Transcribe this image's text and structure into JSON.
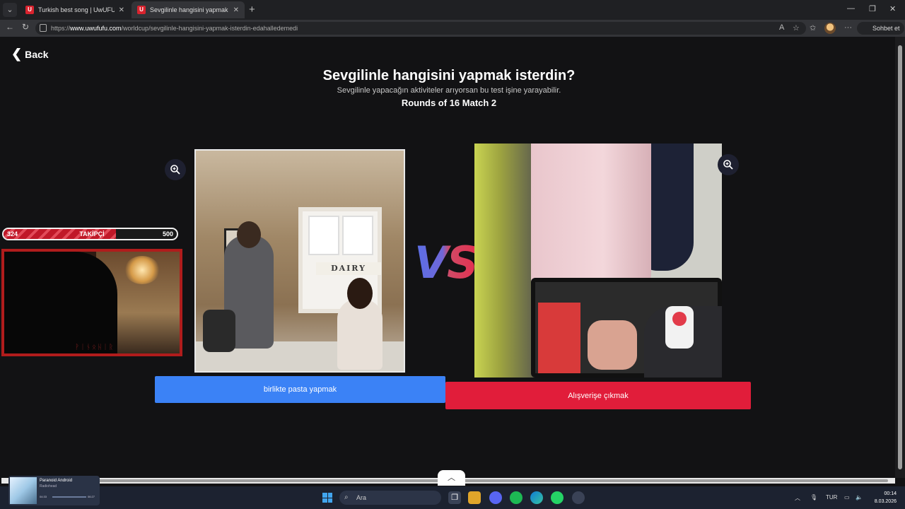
{
  "browser": {
    "tabs": [
      {
        "title": "Turkish best song | UwUFUFU",
        "favicon": "U",
        "active": false
      },
      {
        "title": "Sevgilinle hangisini yapmak isterdin",
        "favicon": "U",
        "active": true
      }
    ],
    "url_prefix": "https://",
    "url_host": "www.uwufufu.com",
    "url_path": "/worldcup/sevgilinle-hangisini-yapmak-isterdin-edahalledemedi",
    "copilot_label": "Sohbet et"
  },
  "page": {
    "back_label": "Back",
    "title": "Sevgilinle hangisini yapmak isterdin?",
    "subtitle": "Sevgilinle yapacağın aktiviteler arıyorsan bu test işine yarayabilir.",
    "round": "Rounds of 16 Match 2",
    "vs": "VS",
    "left_choice": "birlikte pasta yapmak",
    "right_choice": "Alışverişe çıkmak"
  },
  "overlay": {
    "follow_current": "324",
    "follow_label": "TAKİPÇİ",
    "follow_goal": "500",
    "cam_tag": "ᚹᛁᚾᛟᚺᛁᚱ"
  },
  "media": {
    "title": "Paranoid Android",
    "artist": "Radiohead",
    "elapsed": "04:33",
    "total": "06:27"
  },
  "taskbar": {
    "search_placeholder": "Ara",
    "language": "TUR",
    "time": "00:14",
    "date": "8.03.2026"
  },
  "colors": {
    "left_button": "#3b82f6",
    "right_button": "#e11d3a",
    "background": "#121214"
  }
}
